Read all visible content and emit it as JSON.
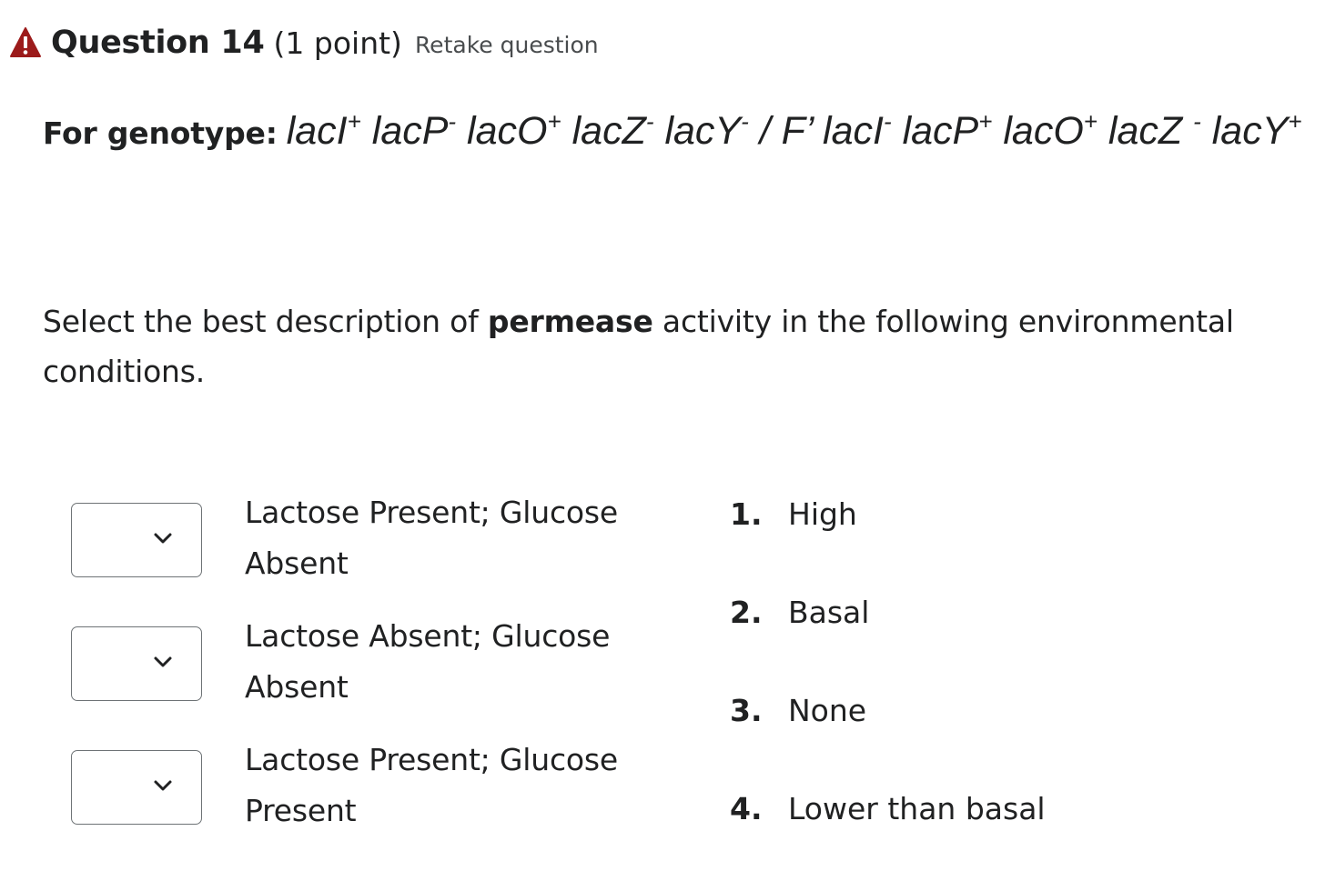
{
  "header": {
    "title": "Question 14",
    "points": "(1 point)",
    "retake_label": "Retake question",
    "warning_color": "#9c1b1b",
    "warning_icon": "warning-triangle-icon"
  },
  "genotype": {
    "label": "For genotype:",
    "seg1": "lacI",
    "sup1": "+",
    "seg2": " lacP",
    "sup2": "-",
    "seg3": " lacO",
    "sup3": "+",
    "seg4": " lacZ",
    "sup4": "-",
    "seg5": " lacY",
    "sup5": "-",
    "seg6": " / F’ lacI",
    "sup6": "-",
    "seg7": " lacP",
    "sup7": "+",
    "seg8": " lacO",
    "sup8": "+",
    "seg9": " lacZ ",
    "sup9": "-",
    "seg10": " lacY",
    "sup10": "+"
  },
  "prompt": {
    "before": "Select the best description of ",
    "bold": "permease",
    "after": " activity in the following environmental conditions."
  },
  "conditions": [
    {
      "label": "Lactose Present; Glucose Absent",
      "selected": ""
    },
    {
      "label": "Lactose Absent; Glucose Absent",
      "selected": ""
    },
    {
      "label": "Lactose Present; Glucose Present",
      "selected": ""
    }
  ],
  "choices": [
    {
      "number": "1.",
      "label": "High"
    },
    {
      "number": "2.",
      "label": "Basal"
    },
    {
      "number": "3.",
      "label": "None"
    },
    {
      "number": "4.",
      "label": "Lower than basal"
    }
  ]
}
